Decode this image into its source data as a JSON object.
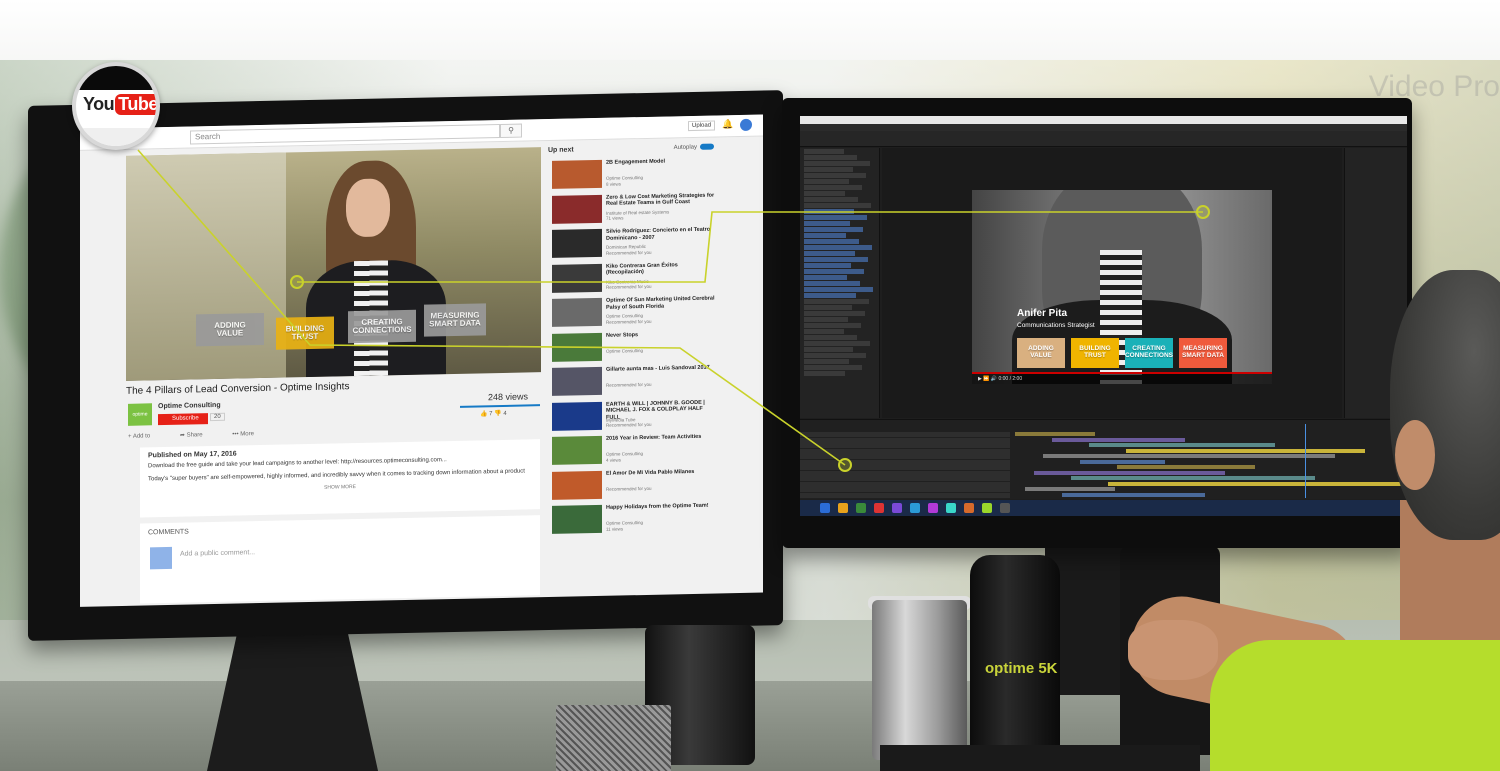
{
  "badge": {
    "you": "You",
    "tube": "Tube"
  },
  "youtube": {
    "search_placeholder": "Search",
    "upload_label": "Upload",
    "video_title": "The 4 Pillars of Lead Conversion - Optime Insights",
    "channel_name": "Optime Consulting",
    "channel_logo_text": "optime",
    "subscribe_label": "Subscribe",
    "subscriber_count": "20",
    "views": "248 views",
    "likes": "7",
    "dislikes": "4",
    "add_to_label": "Add to",
    "share_label": "Share",
    "more_label": "More",
    "published": "Published on May 17, 2016",
    "description_line1": "Download the free guide and take your lead campaigns to another level: http://resources.optimeconsulting.com...",
    "description_line2": "Today's \"super buyers\" are self-empowered, highly informed, and incredibly savvy when it comes to tracking down information about a product",
    "show_more": "SHOW MORE",
    "comments_label": "COMMENTS",
    "comment_placeholder": "Add a public comment...",
    "up_next_label": "Up next",
    "autoplay_label": "Autoplay",
    "pills": [
      {
        "line1": "ADDING",
        "line2": "VALUE",
        "color": "#9a9a9a"
      },
      {
        "line1": "BUILDING",
        "line2": "TRUST",
        "color": "#e9b214"
      },
      {
        "line1": "CREATING",
        "line2": "CONNECTIONS",
        "color": "#9a9a9a"
      },
      {
        "line1": "MEASURING",
        "line2": "SMART DATA",
        "color": "#9a9a9a"
      }
    ],
    "up_next": [
      {
        "title": "2B Engagement Model",
        "sub": "Optime Consulting\n8 views",
        "thumb": "#b85a2e"
      },
      {
        "title": "Zero & Low Cost Marketing Strategies for Real Estate Teams in Gulf Coast",
        "sub": "Institute of Real estate Systems\n71 views",
        "thumb": "#8a2b2b"
      },
      {
        "title": "Silvio Rodríguez: Concierto en el Teatro Dominicano - 2007",
        "sub": "Dominican Republic\nRecommended for you",
        "thumb": "#2a2a2a"
      },
      {
        "title": "Kiko Contreras Gran Éxitos (Recopilación)",
        "sub": "Kiko Contreras Music\nRecommended for you",
        "thumb": "#3a3a3a"
      },
      {
        "title": "Optime Of Sun Marketing United Cerebral Palsy of South Florida",
        "sub": "Optime Consulting\nRecommended for you",
        "thumb": "#6a6a6a"
      },
      {
        "title": "Never Stops",
        "sub": "Optime Consulting",
        "thumb": "#4a7a3a"
      },
      {
        "title": "Gillarte aunta mas - Luis Sandoval 2017",
        "sub": "Recommended for you",
        "thumb": "#556"
      },
      {
        "title": "EARTH & WILL | JOHNNY B. GOODE | MICHAEL J. FOX & COLDPLAY HALF FULL",
        "sub": "MyMedia Tube\nRecommended for you",
        "thumb": "#1a3a8a"
      },
      {
        "title": "2016 Year in Review: Team Activities",
        "sub": "Optime Consulting\n4 views",
        "thumb": "#5a8a3a"
      },
      {
        "title": "El Amor De Mi Vida Pablo Milanes",
        "sub": "Recommended for you",
        "thumb": "#c05a2a"
      },
      {
        "title": "Happy Holidays from the Optime Team!",
        "sub": "Optime Consulting\n11 views",
        "thumb": "#3a6a3a"
      }
    ]
  },
  "after_effects": {
    "name": "Anifer Pita",
    "role": "Communications Strategist",
    "pills": [
      {
        "line1": "ADDING",
        "line2": "VALUE",
        "color": "#d9b080"
      },
      {
        "line1": "BUILDING",
        "line2": "TRUST",
        "color": "#f0b400"
      },
      {
        "line1": "CREATING",
        "line2": "CONNECTIONS",
        "color": "#1ab1b8"
      },
      {
        "line1": "MEASURING",
        "line2": "SMART DATA",
        "color": "#f05a3c"
      }
    ],
    "timecode": "0:00 / 2:00"
  },
  "desk": {
    "bottle_logo": "optime 5K",
    "wall_text": "Video Pro"
  },
  "accent": "#c9d22b"
}
